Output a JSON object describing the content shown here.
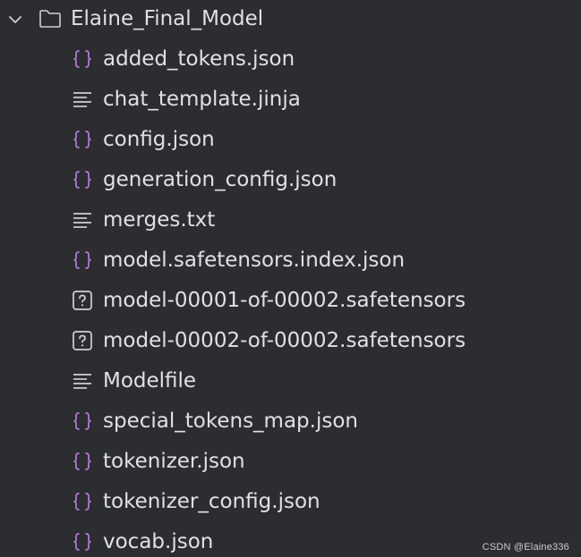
{
  "folder": {
    "name": "Elaine_Final_Model",
    "expanded": true,
    "chevron_icon": "chevron-down-icon",
    "icon": "folder-icon"
  },
  "files": [
    {
      "name": "added_tokens.json",
      "icon": "json-braces-icon"
    },
    {
      "name": "chat_template.jinja",
      "icon": "text-lines-icon"
    },
    {
      "name": "config.json",
      "icon": "json-braces-icon"
    },
    {
      "name": "generation_config.json",
      "icon": "json-braces-icon"
    },
    {
      "name": "merges.txt",
      "icon": "text-lines-icon"
    },
    {
      "name": "model.safetensors.index.json",
      "icon": "json-braces-icon"
    },
    {
      "name": "model-00001-of-00002.safetensors",
      "icon": "unknown-file-icon"
    },
    {
      "name": "model-00002-of-00002.safetensors",
      "icon": "unknown-file-icon"
    },
    {
      "name": "Modelfile",
      "icon": "text-lines-icon"
    },
    {
      "name": "special_tokens_map.json",
      "icon": "json-braces-icon"
    },
    {
      "name": "tokenizer.json",
      "icon": "json-braces-icon"
    },
    {
      "name": "tokenizer_config.json",
      "icon": "json-braces-icon"
    },
    {
      "name": "vocab.json",
      "icon": "json-braces-icon"
    }
  ],
  "watermark": "CSDN @Elaine336",
  "colors": {
    "background": "#2b2d30",
    "text": "#dfe1e5",
    "json_icon": "#b57edc",
    "neutral_icon": "#ced0d6"
  }
}
